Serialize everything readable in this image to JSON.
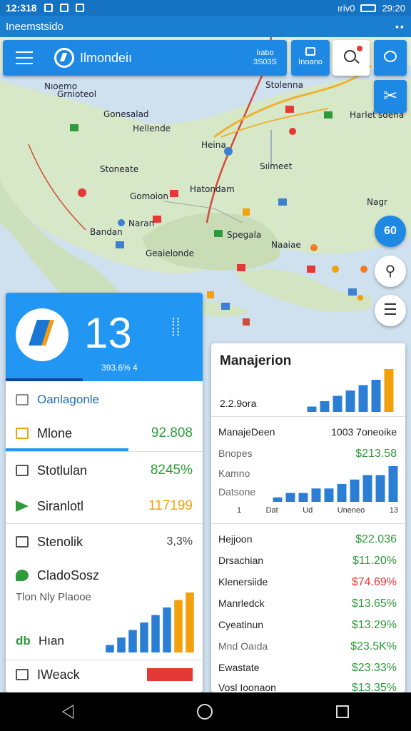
{
  "status": {
    "time": "12:318",
    "right_text": "ıriv0",
    "clock2": "29:20"
  },
  "appbar": {
    "title": "Ineemstsido"
  },
  "search": {
    "app_name": "Ilmondeiı",
    "meta_line1": "Iıatıo",
    "meta_line2": "3S03S"
  },
  "grid_button": {
    "label": "Inoano"
  },
  "fab": {
    "layers_label": "60"
  },
  "map_labels": [
    {
      "text": "Nıoemo",
      "name": "map-label-nioemo"
    },
    {
      "text": "Grnioteol",
      "name": "map-label-grnioteol"
    },
    {
      "text": "Gonesalad",
      "name": "map-label-gonesalad"
    },
    {
      "text": "Hellende",
      "name": "map-label-hellende"
    },
    {
      "text": "Stolenna",
      "name": "map-label-stolenna"
    },
    {
      "text": "Harlet'sdena",
      "name": "map-label-harletsdena"
    },
    {
      "text": "Heina",
      "name": "map-label-heina"
    },
    {
      "text": "Stoneate",
      "name": "map-label-stoneate"
    },
    {
      "text": "Sıimeet",
      "name": "map-label-simeet"
    },
    {
      "text": "Gomoion",
      "name": "map-label-gomoion"
    },
    {
      "text": "Hatondam",
      "name": "map-label-hatondam"
    },
    {
      "text": "Nagr",
      "name": "map-label-nagr"
    },
    {
      "text": "Naran",
      "name": "map-label-naran"
    },
    {
      "text": "Bandan",
      "name": "map-label-bandan"
    },
    {
      "text": "Spegala",
      "name": "map-label-spegala"
    },
    {
      "text": "Geaielonde",
      "name": "map-label-geaielonde"
    },
    {
      "text": "Naaiae",
      "name": "map-label-naaiae"
    }
  ],
  "left_panel": {
    "big_number": "13",
    "sub_value": "393.6% 4",
    "rows": [
      {
        "label": "Oanlagonle",
        "value": "",
        "icon_color": "#8a8a8a",
        "value_color": ""
      },
      {
        "label": "Mlone",
        "value": "92.808",
        "icon_color": "#f2a00c",
        "value_color": "#2e9a3a"
      },
      {
        "label": "Stotlulan",
        "value": "8245%",
        "icon_color": "#555555",
        "value_color": "#2e9a3a"
      },
      {
        "label": "Siranlotl",
        "value": "117199",
        "icon_color": "#2e9a3a",
        "value_color": "#f2a00c"
      },
      {
        "label": "Stenolik",
        "value": "3,3%",
        "icon_color": "#555555",
        "value_color": "#444444"
      },
      {
        "label": "CladoSosz",
        "value": "",
        "icon_color": "#2e9a3a",
        "value_color": ""
      }
    ],
    "chart_label": "Tlon Nly Plaooe",
    "chart_footer_label": "Hıan",
    "chart_footer_icon": "db",
    "bottom_label": "IWeack"
  },
  "right_panel": {
    "title": "Manajerion",
    "subtitle": "2.2.9ora",
    "section_title": "ManajeDeen",
    "section_value": "1003 7oneoike",
    "rows_top": [
      {
        "label": "Bnopes",
        "value": "$213.58",
        "color": "#2e9a3a"
      },
      {
        "label": "Kamno",
        "value": "",
        "color": ""
      },
      {
        "label": "Datsone",
        "value": "",
        "color": ""
      }
    ],
    "chart_x_labels": [
      "1",
      "Dat",
      "Ud",
      "Uneneo",
      "13"
    ],
    "rows_bottom": [
      {
        "label": "Hejjoon",
        "value": "$22.036",
        "color": "#2e9a3a"
      },
      {
        "label": "Drsachian",
        "value": "$11.20%",
        "color": "#2e9a3a"
      },
      {
        "label": "Klenersiide",
        "value": "$74.69%",
        "color": "#e53935"
      },
      {
        "label": "Manrledck",
        "value": "$13.65%",
        "color": "#2e9a3a"
      },
      {
        "label": "Cyeatinun",
        "value": "$13.29%",
        "color": "#2e9a3a"
      },
      {
        "label": "Mnd Oaıda",
        "value": "$23.5K%",
        "color": "#2e9a3a"
      },
      {
        "label": "Ewastate",
        "value": "$23.33%",
        "color": "#2e9a3a"
      },
      {
        "label": "Vosl Ioonaon",
        "value": "$13.35%",
        "color": "#2e9a3a"
      }
    ]
  },
  "chart_data": [
    {
      "type": "bar",
      "name": "left-mini-chart",
      "values": [
        1,
        2,
        3,
        4,
        5,
        6,
        7,
        8
      ],
      "colors": [
        "#2a7fd4",
        "#2a7fd4",
        "#2a7fd4",
        "#2a7fd4",
        "#2a7fd4",
        "#2a7fd4",
        "#f2a00c",
        "#f2a00c"
      ]
    },
    {
      "type": "bar",
      "name": "right-top-chart",
      "values": [
        1,
        2,
        3,
        4,
        5,
        6,
        8
      ],
      "colors": [
        "#2a7fd4",
        "#2a7fd4",
        "#2a7fd4",
        "#2a7fd4",
        "#2a7fd4",
        "#2a7fd4",
        "#f2a00c"
      ]
    },
    {
      "type": "bar",
      "name": "right-mid-chart",
      "values": [
        1,
        2,
        2,
        3,
        3,
        4,
        5,
        6,
        6,
        8
      ],
      "colors": [
        "#2a7fd4",
        "#2a7fd4",
        "#2a7fd4",
        "#2a7fd4",
        "#2a7fd4",
        "#2a7fd4",
        "#2a7fd4",
        "#2a7fd4",
        "#2a7fd4",
        "#2a7fd4"
      ]
    }
  ]
}
